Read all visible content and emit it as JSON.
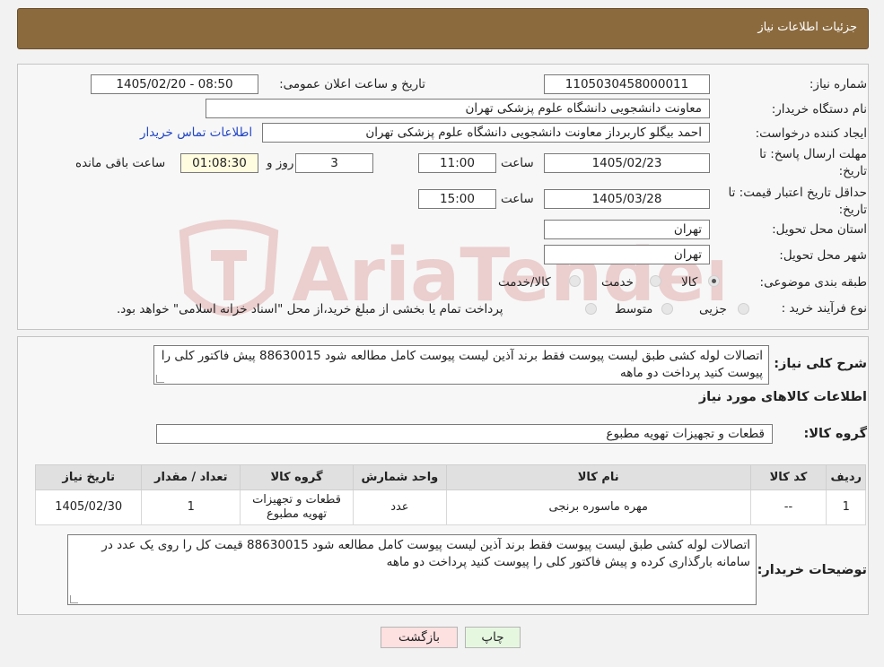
{
  "header": {
    "title": "جزئیات اطلاعات نیاز"
  },
  "fields": {
    "need_number_label": "شماره نیاز:",
    "need_number": "1105030458000011",
    "announce_label": "تاریخ و ساعت اعلان عمومی:",
    "announce_value": "1405/02/20 - 08:50",
    "buyer_org_label": "نام دستگاه خریدار:",
    "buyer_org": "معاونت دانشجویی دانشگاه علوم پزشکی تهران",
    "requester_label": "ایجاد کننده درخواست:",
    "requester": "احمد بیگلو کاربرداز معاونت دانشجویی دانشگاه علوم پزشکی تهران",
    "contact_link": "اطلاعات تماس خریدار",
    "deadline_label": "مهلت ارسال پاسخ: تا تاریخ:",
    "deadline_date": "1405/02/23",
    "time_label": "ساعت",
    "deadline_time": "11:00",
    "days_value": "3",
    "days_label": "روز و",
    "remaining_time": "01:08:30",
    "remaining_label": "ساعت باقی مانده",
    "validity_label": "حداقل تاریخ اعتبار قیمت: تا تاریخ:",
    "validity_date": "1405/03/28",
    "validity_time": "15:00",
    "province_label": "استان محل تحویل:",
    "province": "تهران",
    "city_label": "شهر محل تحویل:",
    "city": "تهران",
    "category_label": "طبقه بندی موضوعی:",
    "category_options": [
      "کالا",
      "خدمت",
      "کالا/خدمت"
    ],
    "category_selected": "کالا",
    "process_label": "نوع فرآیند خرید :",
    "process_options": [
      "جزیی",
      "متوسط"
    ],
    "process_note": "پرداخت تمام یا بخشی از مبلغ خرید،از محل \"اسناد خزانه اسلامی\" خواهد بود."
  },
  "summary": {
    "label": "شرح کلی نیاز:",
    "text": "اتصالات لوله کشی طبق لیست پیوست فقط برند آذین  لیست پیوست کامل مطالعه شود 88630015 پیش فاکتور کلی را پیوست کنید پرداخت دو ماهه",
    "goods_info_title": "اطلاعات کالاهای مورد نیاز",
    "group_label": "گروه کالا:",
    "group_value": "قطعات و تجهیزات تهویه مطبوع"
  },
  "table": {
    "headers": [
      "ردیف",
      "کد کالا",
      "نام کالا",
      "واحد شمارش",
      "گروه کالا",
      "تعداد / مقدار",
      "تاریخ نیاز"
    ],
    "rows": [
      [
        "1",
        "--",
        "مهره ماسوره برنجی",
        "عدد",
        "قطعات و تجهیزات تهویه مطبوع",
        "1",
        "1405/02/30"
      ]
    ]
  },
  "buyer_notes": {
    "label": "توضیحات خریدار:",
    "text": "اتصالات لوله کشی طبق لیست پیوست فقط برند آذین  لیست پیوست کامل مطالعه شود 88630015 قیمت کل را روی یک عدد در سامانه بارگذاری کرده و پیش فاکتور کلی را پیوست کنید پرداخت دو ماهه"
  },
  "buttons": {
    "print": "چاپ",
    "back": "بازگشت"
  },
  "watermark": {
    "text": "AriaTender.neT"
  },
  "colors": {
    "header_bg": "#8b6a3e",
    "link": "#2145c8",
    "back_btn_bg": "#fde0e0",
    "print_btn_bg": "#e6f7e0"
  }
}
